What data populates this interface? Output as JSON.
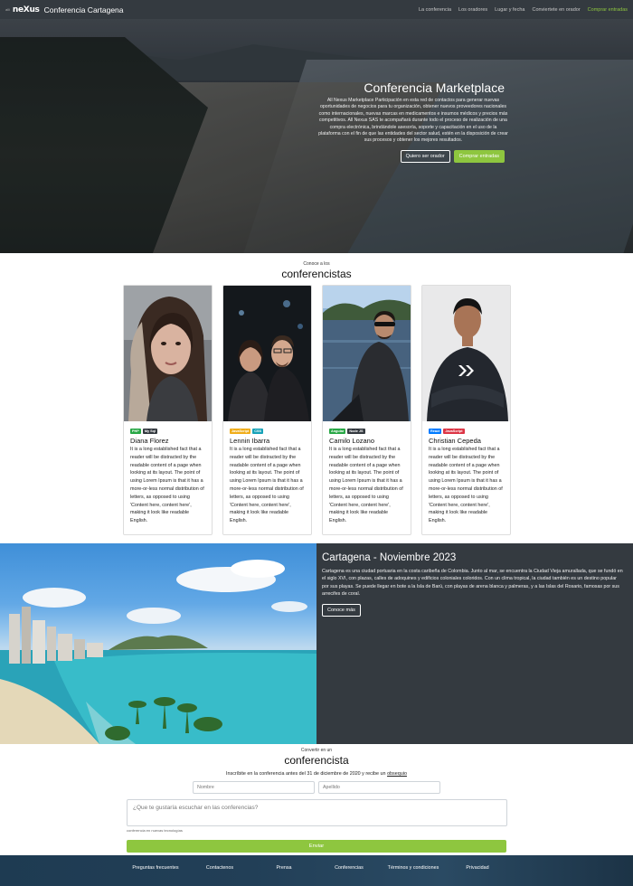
{
  "nav": {
    "logo_small": "alli",
    "logo": "neXus",
    "title": "Conferencia Cartagena",
    "links": [
      "La conferencia",
      "Los oradores",
      "Lugar y fecha",
      "Conviertete en orador",
      "Comprar entradas"
    ]
  },
  "hero": {
    "title": "Conferencia Marketplace",
    "text": "All Nexus Marketplace Participación en esta red de contactos para generar nuevas oportunidades de negocios para tu organización, obtener nuevos proveedores nacionales como internacionales, nuevas marcas en medicamentos e insumos médicos y precios más competitivos. All Nexus SAS te acompañará durante todo el proceso de realización de una compra electrónica, brindándole asesoría, soporte y capacitación en el uso de la plataforma con el fin de que las entidades del sector salud, estén en la disposición de crear sus procesos y obtener los mejores resultados.",
    "btn_speaker": "Quiero ser orador",
    "btn_buy": "Comprar entradas"
  },
  "speakers": {
    "kicker": "Conoce a los",
    "title": "conferencistas",
    "items": [
      {
        "name": "Diana Florez",
        "badges": [
          {
            "label": "PHP",
            "color": "#28a745"
          },
          {
            "label": "My Sql",
            "color": "#343a40"
          }
        ],
        "text": "It is a long established fact that a reader will be distracted by the readable content of a page when looking at its layout. The point of using Lorem Ipsum is that it has a more-or-less normal distribution of letters, as opposed to using 'Content here, content here', making it look like readable English."
      },
      {
        "name": "Lennin Ibarra",
        "badges": [
          {
            "label": "JavaScript",
            "color": "#f0ad1a"
          },
          {
            "label": "CSS",
            "color": "#17a2b8"
          }
        ],
        "text": "It is a long established fact that a reader will be distracted by the readable content of a page when looking at its layout. The point of using Lorem Ipsum is that it has a more-or-less normal distribution of letters, as opposed to using 'Content here, content here', making it look like readable English."
      },
      {
        "name": "Camilo Lozano",
        "badges": [
          {
            "label": "Angular",
            "color": "#28a745"
          },
          {
            "label": "Node JS",
            "color": "#343a40"
          }
        ],
        "text": "It is a long established fact that a reader will be distracted by the readable content of a page when looking at its layout. The point of using Lorem Ipsum is that it has a more-or-less normal distribution of letters, as opposed to using 'Content here, content here', making it look like readable English."
      },
      {
        "name": "Christian Cepeda",
        "badges": [
          {
            "label": "React",
            "color": "#007bff"
          },
          {
            "label": "JavaScript",
            "color": "#dc3545"
          }
        ],
        "text": "It is a long established fact that a reader will be distracted by the readable content of a page when looking at its layout. The point of using Lorem Ipsum is that it has a more-or-less normal distribution of letters, as opposed to using 'Content here, content here', making it look like readable English."
      }
    ]
  },
  "cartagena": {
    "title": "Cartagena - Noviembre 2023",
    "text": "Cartagena es una ciudad portuaria en la costa caribeña de Colombia. Junto al mar, se encuentra la Ciudad Vieja amurallada, que se fundó en el siglo XVI, con plazas, calles de adoquines y edificios coloniales coloridos. Con un clima tropical, la ciudad también es un destino popular por sus playas. Se puede llegar en bote a la Isla de Barú, con playas de arena blanca y palmeras, y a las Islas del Rosario, famosas por sus arrecifes de coral.",
    "button": "Conoce más"
  },
  "form": {
    "kicker": "Convertir en un",
    "title": "conferencista",
    "note_before": "Inscríbite en la conferencia antes del 31 de diciembre de 2020 y recibe un ",
    "note_link": "obsequio",
    "first_name_placeholder": "Nombre",
    "last_name_placeholder": "Apellido",
    "message_placeholder": "¿Que te gustaría escuchar en las conferencias?",
    "help": "conferencia en nuevas tecnologías",
    "submit": "Enviar"
  },
  "footer": {
    "links": [
      "Preguntas frecuentes",
      "Contactenos",
      "Prensa",
      "Conferencias",
      "Términos y condiciones",
      "Privacidad"
    ]
  },
  "colors": {
    "accent": "#8ec63f",
    "dark": "#343a40",
    "footer": "#1e3b52"
  }
}
